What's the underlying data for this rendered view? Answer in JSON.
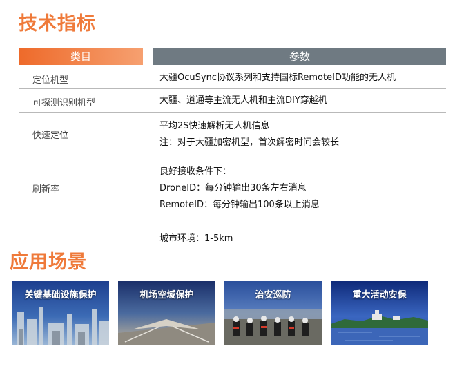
{
  "sections": {
    "specs_title": "技术指标",
    "applications_title": "应用场景"
  },
  "table": {
    "headers": {
      "category": "类目",
      "parameter": "参数"
    },
    "rows": [
      {
        "label": "定位机型",
        "lines": [
          "大疆OcuSync协议系列和支持国标RemoteID功能的无人机"
        ]
      },
      {
        "label": "可探测识别机型",
        "lines": [
          "大疆、道通等主流无人机和主流DIY穿越机"
        ]
      },
      {
        "label": "快速定位",
        "lines": [
          "平均2S快速解析无人机信息",
          "注：对于大疆加密机型，首次解密时间会较长"
        ]
      },
      {
        "label": "刷新率",
        "lines": [
          "良好接收条件下：",
          "DroneID：每分钟输出30条左右消息",
          "RemoteID：每分钟输出100条以上消息"
        ]
      }
    ],
    "extra_line": "城市环境：1-5km"
  },
  "applications": [
    {
      "caption": "关键基础设施保护",
      "image": "industrial-plant-image"
    },
    {
      "caption": "机场空域保护",
      "image": "airport-image"
    },
    {
      "caption": "治安巡防",
      "image": "police-patrol-image"
    },
    {
      "caption": "重大活动安保",
      "image": "city-lake-image"
    }
  ],
  "colors": {
    "accent": "#ef7a3a",
    "header_gray": "#6f7a82"
  }
}
